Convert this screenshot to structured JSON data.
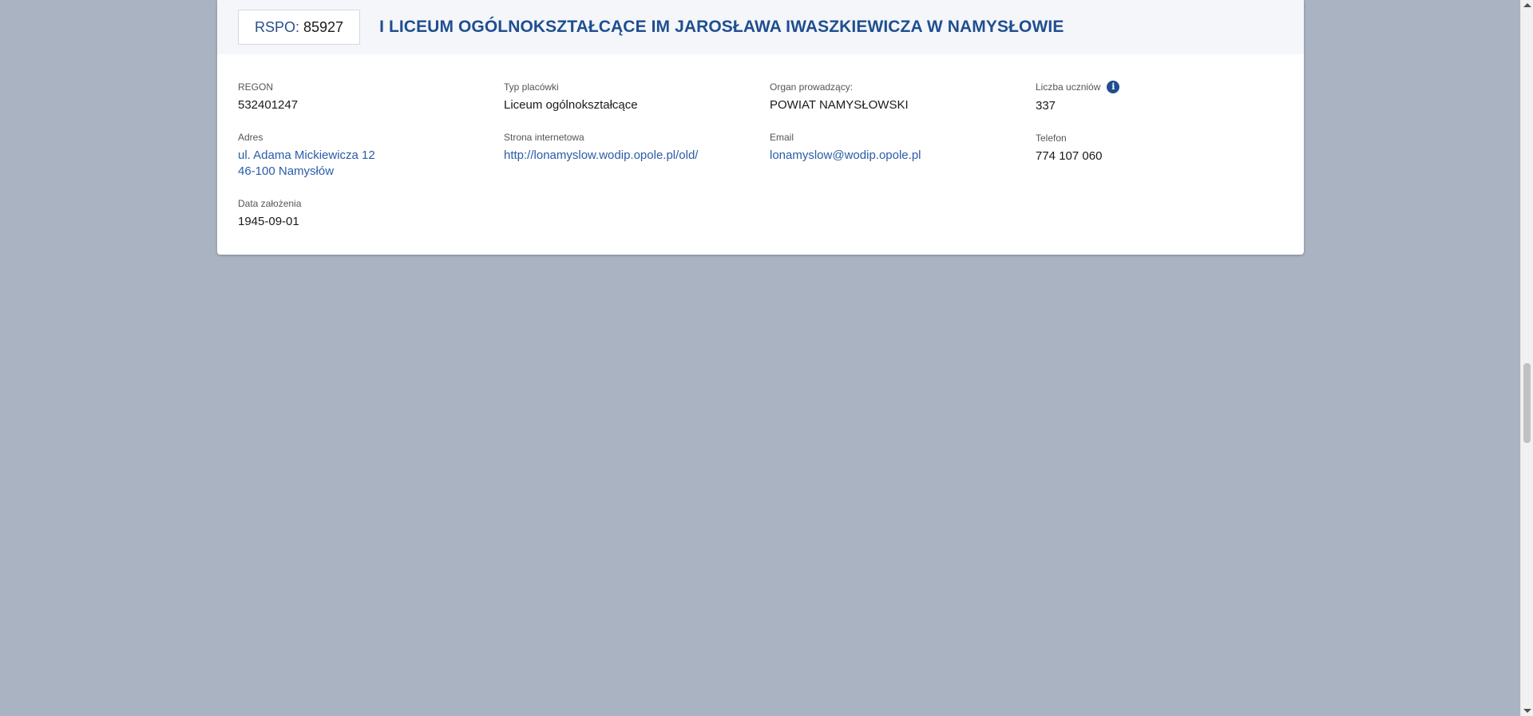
{
  "school": {
    "rspo_label": "RSPO:",
    "rspo_value": "85927",
    "name": "I LICEUM OGÓLNOKSZTAŁCĄCE IM JAROSŁAWA IWASZKIEWICZA W NAMYSŁOWIE"
  },
  "fields": {
    "regon": {
      "label": "REGON",
      "value": "532401247"
    },
    "typ": {
      "label": "Typ placówki",
      "value": "Liceum ogólnokształcące"
    },
    "organ": {
      "label": "Organ prowadzący:",
      "value": "POWIAT NAMYSŁOWSKI"
    },
    "uczniowie": {
      "label": "Liczba uczniów",
      "value": "337",
      "icon": "info-icon"
    },
    "adres": {
      "label": "Adres",
      "line1": "ul. Adama Mickiewicza 12",
      "line2": "46-100 Namysłów"
    },
    "strona": {
      "label": "Strona internetowa",
      "value": "http://lonamyslow.wodip.opole.pl/old/"
    },
    "email": {
      "label": "Email",
      "value": "lonamyslow@wodip.opole.pl"
    },
    "telefon": {
      "label": "Telefon",
      "value": "774 107 060"
    },
    "data": {
      "label": "Data założenia",
      "value": "1945-09-01"
    }
  },
  "colors": {
    "background": "#a9b3c1",
    "accent": "#1f4e8f",
    "link": "#2a5ca8"
  }
}
